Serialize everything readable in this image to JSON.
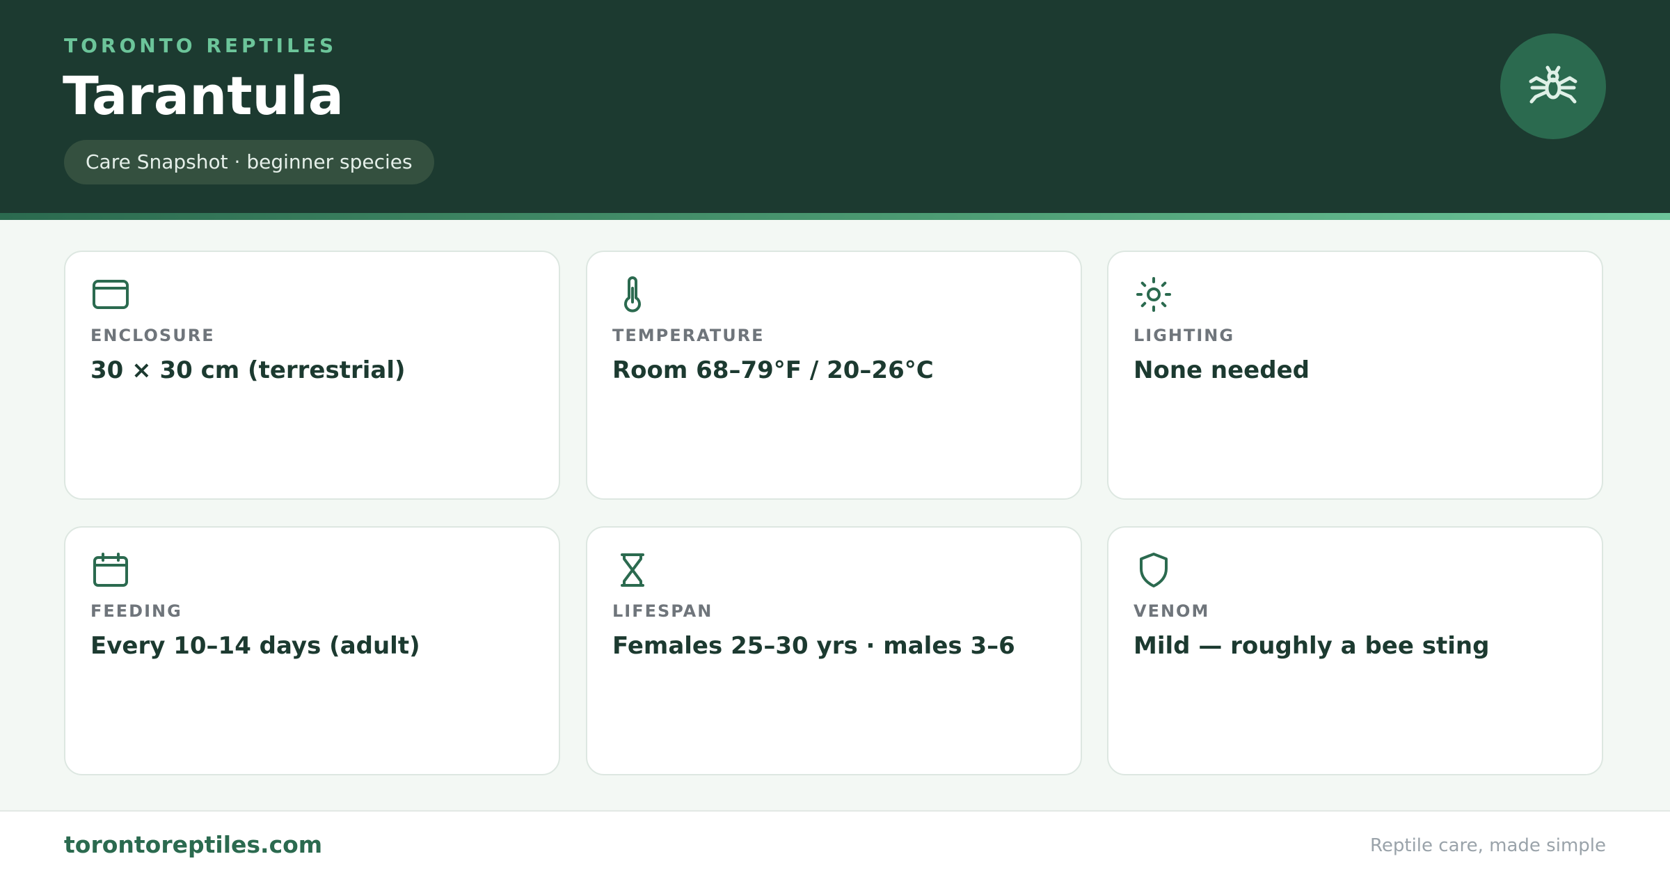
{
  "header": {
    "brand": "TORONTO REPTILES",
    "title": "Tarantula",
    "subtitle_pill": "Care Snapshot · beginner species",
    "badge_icon": "spider-icon"
  },
  "cards": [
    {
      "icon": "enclosure-icon",
      "label": "ENCLOSURE",
      "value": "30 × 30 cm (terrestrial)"
    },
    {
      "icon": "thermometer-icon",
      "label": "TEMPERATURE",
      "value": "Room 68–79°F / 20–26°C"
    },
    {
      "icon": "sun-icon",
      "label": "LIGHTING",
      "value": "None needed"
    },
    {
      "icon": "calendar-icon",
      "label": "FEEDING",
      "value": "Every 10–14 days (adult)"
    },
    {
      "icon": "hourglass-icon",
      "label": "LIFESPAN",
      "value": "Females 25–30 yrs · males 3–6"
    },
    {
      "icon": "shield-icon",
      "label": "VENOM",
      "value": "Mild — roughly a bee sting"
    }
  ],
  "footer": {
    "site": "torontoreptiles.com",
    "tagline": "Reptile care, made simple"
  },
  "colors": {
    "header_bg": "#1c3a30",
    "accent": "#6cc59a",
    "brand_green": "#2b6a4f",
    "page_bg": "#f3f8f4",
    "label_gray": "#6f757b"
  }
}
